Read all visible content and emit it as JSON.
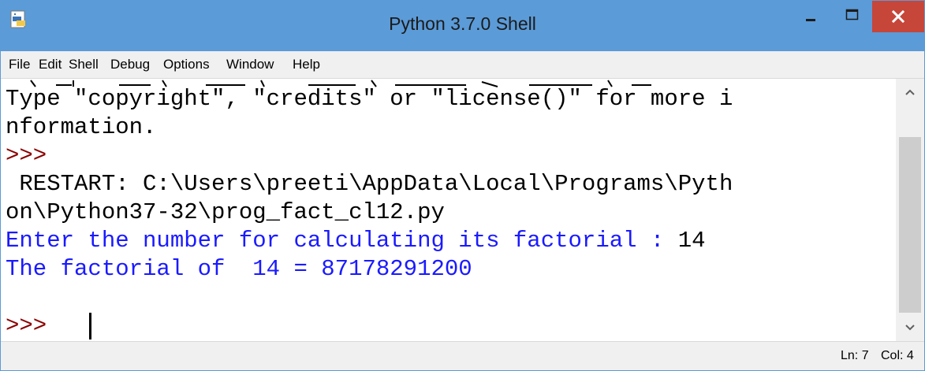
{
  "window": {
    "title": "Python 3.7.0 Shell"
  },
  "menu": [
    "File",
    "Edit",
    "Shell",
    "Debug",
    "Options",
    "Window",
    "Help"
  ],
  "shell_lines": [
    {
      "text": "Type \"copyright\", \"credits\" or \"license()\" for more i",
      "kind": "output"
    },
    {
      "text": "nformation.",
      "kind": "output"
    },
    {
      "text": ">>>",
      "kind": "prompt"
    },
    {
      "text": " RESTART: C:\\Users\\preeti\\AppData\\Local\\Programs\\Pyth",
      "kind": "output"
    },
    {
      "text": "on\\Python37-32\\prog_fact_cl12.py",
      "kind": "output"
    },
    {
      "prefix": "Enter the number for calculating its factorial : ",
      "input": "14",
      "kind": "stdout_input"
    },
    {
      "text": "The factorial of  14 = 87178291200",
      "kind": "stdout"
    },
    {
      "text": ">>> ",
      "kind": "prompt"
    }
  ],
  "status": {
    "line": "Ln: 7",
    "col": "Col: 4"
  },
  "colors": {
    "titlebar": "#5b9bd8",
    "close_button": "#c7463a",
    "prompt": "#8b0000",
    "stdout": "#1a1aff"
  },
  "icons": {
    "app": "python-idle-icon",
    "minimize": "minimize-icon",
    "maximize": "maximize-icon",
    "close": "close-icon",
    "scroll_up": "chevron-up-icon",
    "scroll_down": "chevron-down-icon"
  }
}
